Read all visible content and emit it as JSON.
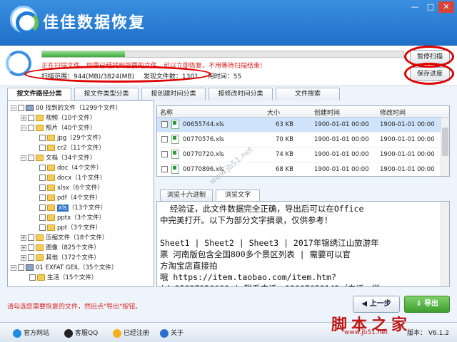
{
  "window": {
    "title": "佳佳数据恢复",
    "btn_min": "—",
    "btn_max": "□",
    "btn_close": "✕"
  },
  "scan": {
    "progress": 0.23,
    "message": "正在扫描文件，如果已经找到您要的文件，可以立即恢复，不用等待扫描结束!",
    "range": "扫描范围：944(MB)/3824(MB)",
    "found": "发现文件数：1301",
    "elapsed": "用时间：55",
    "pause_label": "暂停扫描",
    "save_label": "保存进度"
  },
  "tabs": [
    "按文件路径分类",
    "按文件类型分类",
    "按创建时间分类",
    "按修改时间分类",
    "文件搜索"
  ],
  "tree": [
    {
      "label": "00 找到的文件",
      "count": "（1299个文件）",
      "level": 0,
      "kind": "drive",
      "exp": "−"
    },
    {
      "label": "视频",
      "count": "（10个文件）",
      "level": 1,
      "kind": "folder",
      "exp": "+"
    },
    {
      "label": "照片",
      "count": "（40个文件）",
      "level": 1,
      "kind": "folder",
      "exp": "−"
    },
    {
      "label": "jpg",
      "count": "（29个文件）",
      "level": 2,
      "kind": "folder",
      "exp": ""
    },
    {
      "label": "cr2",
      "count": "（11个文件）",
      "level": 2,
      "kind": "folder",
      "exp": ""
    },
    {
      "label": "文档",
      "count": "（34个文件）",
      "level": 1,
      "kind": "folder",
      "exp": "−"
    },
    {
      "label": "doc",
      "count": "（4个文件）",
      "level": 2,
      "kind": "folder",
      "exp": ""
    },
    {
      "label": "docx",
      "count": "（1个文件）",
      "level": 2,
      "kind": "folder",
      "exp": ""
    },
    {
      "label": "xlsx",
      "count": "（6个文件）",
      "level": 2,
      "kind": "folder",
      "exp": ""
    },
    {
      "label": "pdf",
      "count": "（4个文件）",
      "level": 2,
      "kind": "folder",
      "exp": ""
    },
    {
      "label": "xls",
      "count": "（13个文件）",
      "level": 2,
      "kind": "folder",
      "exp": "",
      "selected": true
    },
    {
      "label": "pptx",
      "count": "（3个文件）",
      "level": 2,
      "kind": "folder",
      "exp": ""
    },
    {
      "label": "ppt",
      "count": "（3个文件）",
      "level": 2,
      "kind": "folder",
      "exp": ""
    },
    {
      "label": "压缩文件",
      "count": "（18个文件）",
      "level": 1,
      "kind": "folder",
      "exp": "+"
    },
    {
      "label": "图像",
      "count": "（825个文件）",
      "level": 1,
      "kind": "folder",
      "exp": "+"
    },
    {
      "label": "其他",
      "count": "（372个文件）",
      "level": 1,
      "kind": "folder",
      "exp": "+"
    },
    {
      "label": "01 EXFAT GEIL",
      "count": "（35个文件）",
      "level": 0,
      "kind": "drive",
      "exp": "−"
    },
    {
      "label": "生活",
      "count": "（15个文件）",
      "level": 1,
      "kind": "folder",
      "exp": ""
    }
  ],
  "filelist": {
    "headers": [
      "名称",
      "大小",
      "创建时间",
      "修改时间"
    ],
    "rows": [
      {
        "name": "00655744.xls",
        "size": "63 KB",
        "created": "1900-01-01 00:00",
        "modified": "1900-01-01 00:00",
        "selected": true
      },
      {
        "name": "00770576.xls",
        "size": "70 KB",
        "created": "1900-01-01 00:00",
        "modified": "1900-01-01 00:00"
      },
      {
        "name": "00770720.xls",
        "size": "74 KB",
        "created": "1900-01-01 00:00",
        "modified": "1900-01-01 00:00"
      },
      {
        "name": "00770896.xls",
        "size": "68 KB",
        "created": "1900-01-01 00:00",
        "modified": "1900-01-01 00:00"
      }
    ]
  },
  "preview": {
    "tabs": [
      "浏览十六进制",
      "浏览文字"
    ],
    "lines": [
      "  经验证，此文件数据完全正确，导出后可以在Office",
      "中完美打开。以下为部分文字摘录，仅供参考！",
      "",
      "Sheet1 | Sheet2 | Sheet3 | 2017年锦绣江山旅游年",
      "票 河南版包含全国800多个景区列表 | 需要可以官",
      "方淘宝店直接拍",
      "哦 https://item.taobao.com/item.htm?",
      "id=35837950660 | 联系电话：13007658143（电话，微"
    ]
  },
  "hint": "请勾选您需要恢复的文件，然后点\"导出\"按钮。",
  "nav": {
    "prev": "上一步",
    "export": "导出"
  },
  "statusbar": {
    "site": "官方网站",
    "qq": "客服QQ",
    "registered": "已经注册",
    "about": "关于",
    "version": "版本： V6.1.2"
  },
  "watermark": {
    "text": "脚本之家",
    "url": "www.jb51.net",
    "diag": "www.jb51.net"
  },
  "colors": {
    "titlebar": "#2a80d6",
    "red": "#dd2222",
    "progress": "#4cb548",
    "export": "#4cae3a"
  }
}
